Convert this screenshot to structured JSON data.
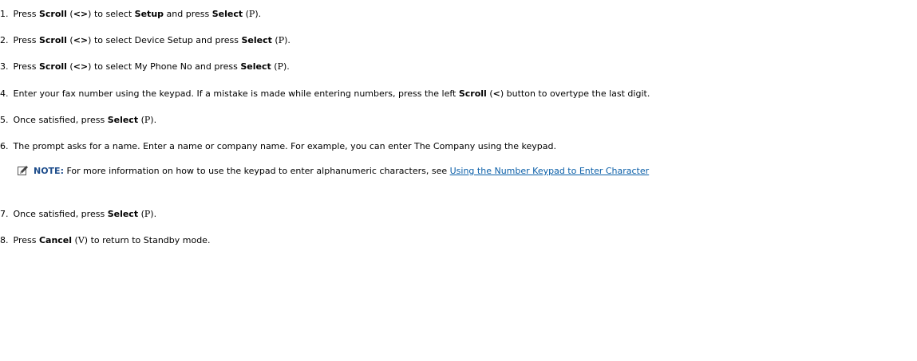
{
  "steps": [
    {
      "num": "1.",
      "t1": "Press ",
      "b1": "Scroll",
      "t2": " (",
      "b2": "<>",
      "t3": ") to select ",
      "b3": "Setup",
      "t4": " and press ",
      "b4": "Select",
      "t5": " (",
      "s1": "P",
      "t6": ")."
    },
    {
      "num": "2.",
      "t1": "Press ",
      "b1": "Scroll",
      "t2": " (",
      "b2": "<>",
      "t3": ") to select Device Setup and press ",
      "b3": "Select",
      "t4": " (",
      "s1": "P",
      "t5": ")."
    },
    {
      "num": "3.",
      "t1": "Press ",
      "b1": "Scroll",
      "t2": " (",
      "b2": "<>",
      "t3": ") to select My Phone No and press ",
      "b3": "Select",
      "t4": " (",
      "s1": "P",
      "t5": ")."
    },
    {
      "num": "4.",
      "t1": "Enter your fax number using the keypad. If a mistake is made while entering numbers, press the left ",
      "b1": "Scroll",
      "t2": " (",
      "b2": "<",
      "t3": ") button to overtype the last digit."
    },
    {
      "num": "5.",
      "t1": "Once satisfied, press ",
      "b1": "Select",
      "t2": " (",
      "s1": "P",
      "t3": ")."
    },
    {
      "num": "6.",
      "t1": "The prompt asks for a name. Enter a name or company name. For example, you can enter The Company using the keypad."
    },
    {
      "num": "7.",
      "t1": "Once satisfied, press ",
      "b1": "Select",
      "t2": " (",
      "s1": "P",
      "t3": ")."
    },
    {
      "num": "8.",
      "t1": "Press ",
      "b1": "Cancel",
      "t2": " (",
      "s1": "V",
      "t3": ") to return to Standby mode."
    }
  ],
  "note": {
    "label": "NOTE:",
    "text": " For more information on how to use the keypad to enter alphanumeric characters, see ",
    "link": "Using the Number Keypad to Enter Character",
    "icon": "pencil-note-icon"
  }
}
